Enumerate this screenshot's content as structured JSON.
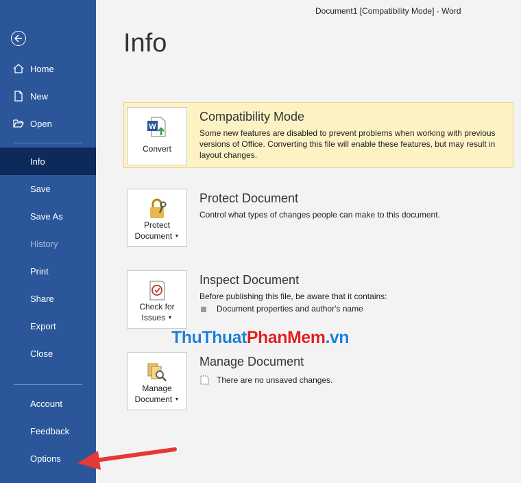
{
  "window": {
    "title": "Document1 [Compatibility Mode]  -  Word"
  },
  "page": {
    "heading": "Info"
  },
  "sidebar": {
    "top": [
      {
        "label": "Home",
        "icon": "home-icon"
      },
      {
        "label": "New",
        "icon": "new-document-icon"
      },
      {
        "label": "Open",
        "icon": "open-folder-icon"
      }
    ],
    "middle": [
      {
        "label": "Info",
        "state": "active"
      },
      {
        "label": "Save"
      },
      {
        "label": "Save As"
      },
      {
        "label": "History",
        "state": "disabled"
      },
      {
        "label": "Print"
      },
      {
        "label": "Share"
      },
      {
        "label": "Export"
      },
      {
        "label": "Close"
      }
    ],
    "bottom": [
      {
        "label": "Account"
      },
      {
        "label": "Feedback"
      },
      {
        "label": "Options"
      }
    ]
  },
  "sections": {
    "compatibility": {
      "button": "Convert",
      "title": "Compatibility Mode",
      "description": "Some new features are disabled to prevent problems when working with previous versions of Office. Converting this file will enable these features, but may result in layout changes."
    },
    "protect": {
      "button_line1": "Protect",
      "button_line2": "Document",
      "title": "Protect Document",
      "description": "Control what types of changes people can make to this document."
    },
    "inspect": {
      "button_line1": "Check for",
      "button_line2": "Issues",
      "title": "Inspect Document",
      "description": "Before publishing this file, be aware that it contains:",
      "items": [
        "Document properties and author's name"
      ]
    },
    "manage": {
      "button_line1": "Manage",
      "button_line2": "Document",
      "title": "Manage Document",
      "items": [
        "There are no unsaved changes."
      ]
    }
  },
  "watermark": {
    "part1": "ThuThuat",
    "part2": "PhanMem",
    "part3": ".vn"
  },
  "colors": {
    "sidebar": "#2b579a",
    "active": "#0e2a5a",
    "compat_bg": "#fdf2c4",
    "arrow": "#e53935"
  }
}
